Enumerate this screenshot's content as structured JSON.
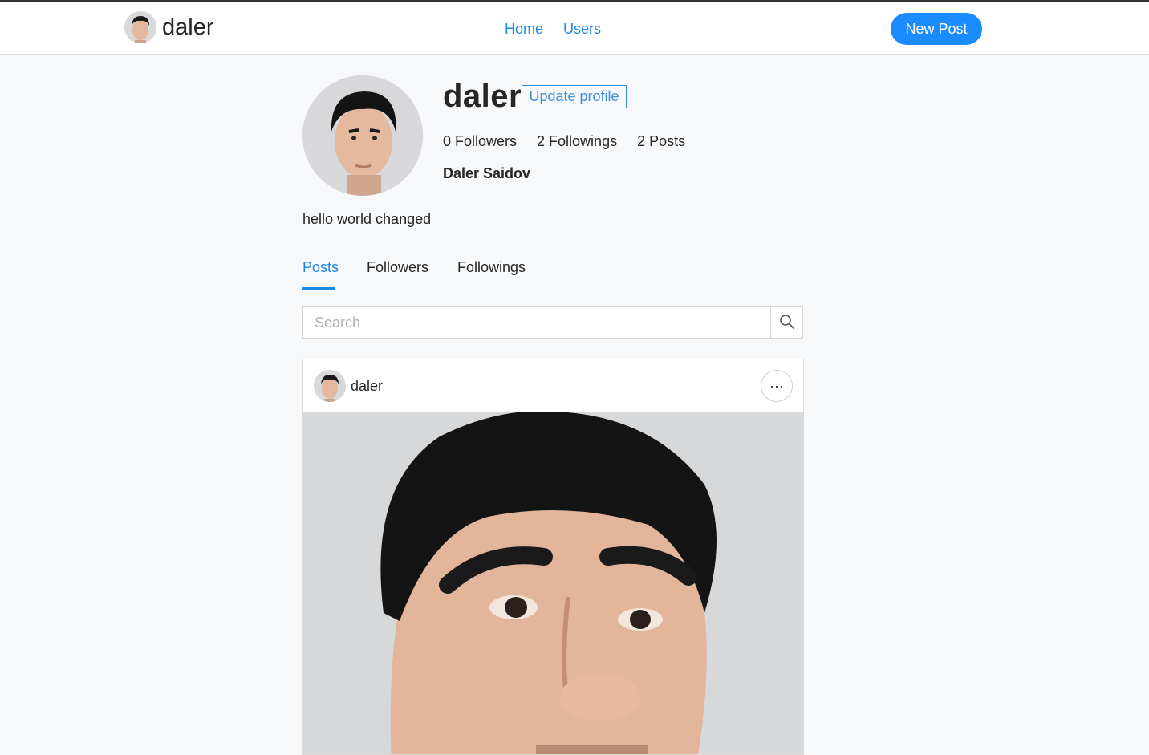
{
  "navbar": {
    "brand_name": "daler",
    "links": [
      {
        "label": "Home"
      },
      {
        "label": "Users"
      }
    ],
    "new_post_label": "New Post"
  },
  "profile": {
    "username": "daler",
    "update_label": "Update profile",
    "followers": "0 Followers",
    "followings": "2 Followings",
    "posts": "2 Posts",
    "full_name": "Daler Saidov",
    "bio": "hello world changed"
  },
  "tabs": [
    {
      "label": "Posts",
      "active": true
    },
    {
      "label": "Followers",
      "active": false
    },
    {
      "label": "Followings",
      "active": false
    }
  ],
  "search": {
    "placeholder": "Search"
  },
  "post": {
    "author": "daler",
    "more_label": "···"
  },
  "colors": {
    "accent": "#1e88e5",
    "button": "#1a8cff",
    "background": "#f7f8fa"
  },
  "icons": [
    "avatar-photo",
    "search-icon",
    "more-icon",
    "post-photo"
  ]
}
